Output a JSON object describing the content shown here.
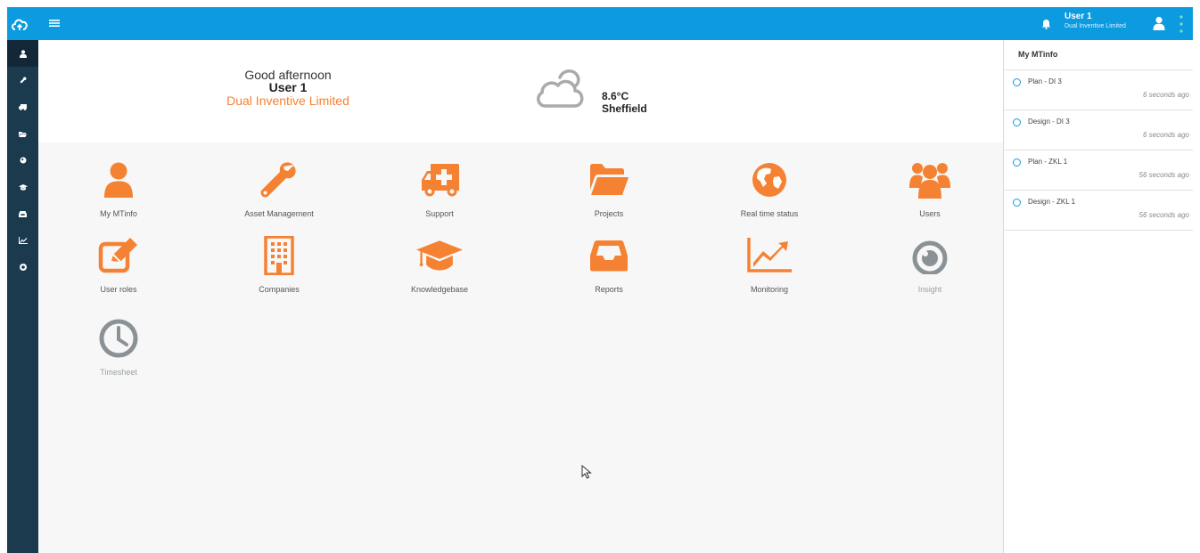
{
  "colors": {
    "accent": "#0d9be0",
    "brand_orange": "#f58233",
    "sidebar": "#1c3a4e",
    "disabled_gray": "#8a9296"
  },
  "header": {
    "user_name": "User 1",
    "company": "Dual Inventive Limited",
    "icons": [
      "cloud-logo-icon",
      "hamburger-menu-icon",
      "bell-icon",
      "user-avatar-icon",
      "kebab-menu-icon"
    ]
  },
  "sidebar": {
    "items": [
      {
        "icon": "user-icon",
        "active": true
      },
      {
        "icon": "wrench-icon"
      },
      {
        "icon": "ambulance-icon"
      },
      {
        "icon": "folder-icon"
      },
      {
        "icon": "globe-icon"
      },
      {
        "icon": "graduation-cap-icon"
      },
      {
        "icon": "inbox-icon"
      },
      {
        "icon": "line-chart-icon"
      },
      {
        "icon": "gear-icon"
      }
    ]
  },
  "greeting": {
    "salutation": "Good afternoon",
    "name": "User 1",
    "company": "Dual Inventive Limited"
  },
  "weather": {
    "temperature": "8.6°C",
    "location": "Sheffield",
    "icon": "cloud-icon"
  },
  "tiles": [
    {
      "label": "My MTinfo",
      "icon": "user-icon"
    },
    {
      "label": "Asset Management",
      "icon": "wrench-icon"
    },
    {
      "label": "Support",
      "icon": "ambulance-icon"
    },
    {
      "label": "Projects",
      "icon": "folder-open-icon"
    },
    {
      "label": "Real time status",
      "icon": "globe-icon"
    },
    {
      "label": "Users",
      "icon": "users-icon"
    },
    {
      "label": "User roles",
      "icon": "edit-icon"
    },
    {
      "label": "Companies",
      "icon": "building-icon"
    },
    {
      "label": "Knowledgebase",
      "icon": "graduation-cap-icon"
    },
    {
      "label": "Reports",
      "icon": "inbox-icon"
    },
    {
      "label": "Monitoring",
      "icon": "area-chart-icon"
    },
    {
      "label": "Insight",
      "icon": "target-icon",
      "disabled": true
    },
    {
      "label": "Timesheet",
      "icon": "clock-icon",
      "disabled": true
    }
  ],
  "right_panel": {
    "title": "My MTinfo",
    "items": [
      {
        "title": "Plan - DI 3",
        "time": "6 seconds ago"
      },
      {
        "title": "Design - DI 3",
        "time": "6 seconds ago"
      },
      {
        "title": "Plan - ZKL 1",
        "time": "56 seconds ago"
      },
      {
        "title": "Design - ZKL 1",
        "time": "56 seconds ago"
      }
    ]
  }
}
